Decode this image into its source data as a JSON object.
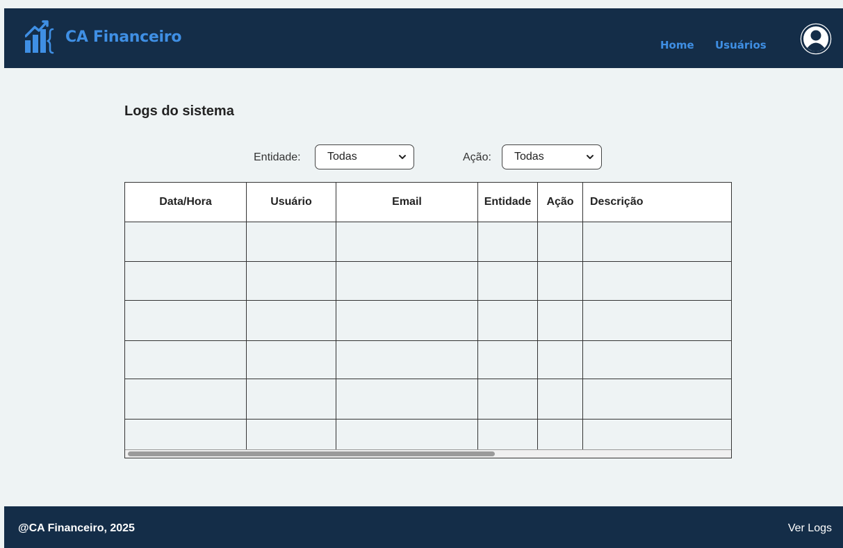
{
  "header": {
    "brand": "CA Financeiro",
    "nav": [
      "Home",
      "Usuários"
    ]
  },
  "main": {
    "title": "Logs do sistema",
    "filters": {
      "entity_label": "Entidade:",
      "entity_value": "Todas",
      "action_label": "Ação:",
      "action_value": "Todas"
    },
    "table": {
      "columns": [
        "Data/Hora",
        "Usuário",
        "Email",
        "Entidade",
        "Ação",
        "Descrição"
      ],
      "rows": [
        [
          "",
          "",
          "",
          "",
          "",
          ""
        ],
        [
          "",
          "",
          "",
          "",
          "",
          ""
        ],
        [
          "",
          "",
          "",
          "",
          "",
          ""
        ],
        [
          "",
          "",
          "",
          "",
          "",
          ""
        ],
        [
          "",
          "",
          "",
          "",
          "",
          ""
        ],
        [
          "",
          "",
          "",
          "",
          "",
          ""
        ]
      ]
    }
  },
  "footer": {
    "copyright": "@CA Financeiro, 2025",
    "logs_link": "Ver Logs"
  },
  "colors": {
    "header_bg": "#142d48",
    "accent": "#3f8fe4",
    "page_bg": "#eef3f4"
  },
  "icons": [
    "logo-icon",
    "user-avatar-icon",
    "chevron-down-icon"
  ]
}
